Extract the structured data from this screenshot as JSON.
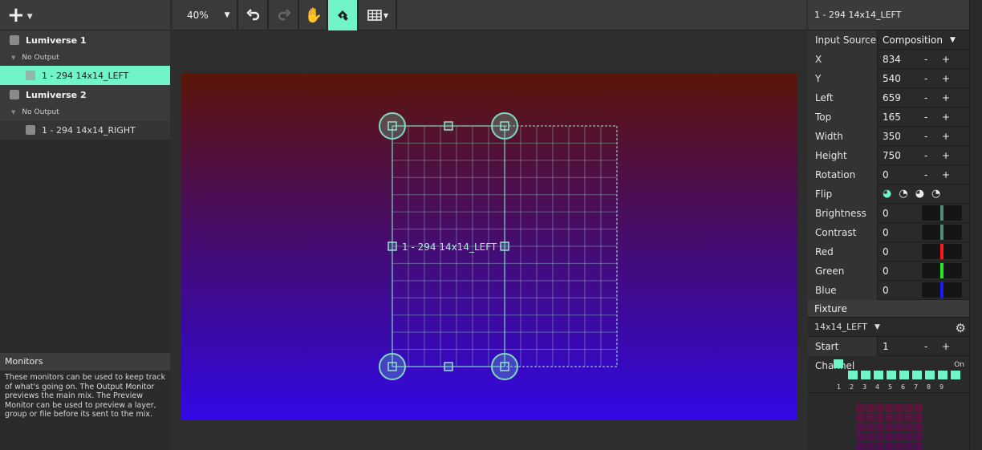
{
  "left_panel": {
    "universes": [
      {
        "name": "Lumiverse 1",
        "output": "No Output",
        "fixtures": [
          {
            "label": "1 - 294 14x14_LEFT",
            "selected": true
          }
        ]
      },
      {
        "name": "Lumiverse 2",
        "output": "No Output",
        "fixtures": [
          {
            "label": "1 - 294 14x14_RIGHT",
            "selected": false
          }
        ]
      }
    ],
    "monitors": {
      "title": "Monitors",
      "description": "These monitors can be used to keep track of what's going on. The Output Monitor previews the main mix. The Preview Monitor can be used to preview a layer, group or file before its sent to the mix."
    }
  },
  "toolbar": {
    "zoom": "40%"
  },
  "stage": {
    "fixture_label": "1 - 294 14x14_LEFT",
    "grid_cols": 14,
    "grid_rows": 14
  },
  "right_panel": {
    "title": "1 - 294 14x14_LEFT",
    "input_source_label": "Input Source",
    "input_source_value": "Composition",
    "props": [
      {
        "label": "X",
        "value": "834"
      },
      {
        "label": "Y",
        "value": "540"
      },
      {
        "label": "Left",
        "value": "659"
      },
      {
        "label": "Top",
        "value": "165"
      },
      {
        "label": "Width",
        "value": "350"
      },
      {
        "label": "Height",
        "value": "750"
      },
      {
        "label": "Rotation",
        "value": "0"
      }
    ],
    "flip_label": "Flip",
    "color_props": [
      {
        "label": "Brightness",
        "value": "0",
        "color": "#4f8a7a"
      },
      {
        "label": "Contrast",
        "value": "0",
        "color": "#4f8a7a"
      },
      {
        "label": "Red",
        "value": "0",
        "color": "#ff1a1a"
      },
      {
        "label": "Green",
        "value": "0",
        "color": "#22e822"
      },
      {
        "label": "Blue",
        "value": "0",
        "color": "#1a1aff"
      }
    ],
    "minus": "-",
    "plus": "+",
    "fixture_section": "Fixture",
    "fixture_value": "14x14_LEFT",
    "start_channel_label": "Start Channel",
    "start_channel_value": "1",
    "channels_on": "On",
    "channel_numbers": [
      "1",
      "2",
      "3",
      "4",
      "5",
      "6",
      "7",
      "8",
      "9"
    ]
  },
  "colors": {
    "accent": "#6ff5c8"
  }
}
